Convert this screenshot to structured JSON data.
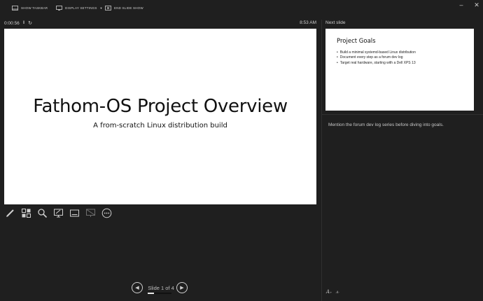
{
  "toolbar": {
    "show_taskbar": "SHOW TASKBAR",
    "display_settings": "DISPLAY SETTINGS",
    "end_slide_show": "END SLIDE SHOW"
  },
  "window": {
    "minimize": "–",
    "close": "✕"
  },
  "presenter": {
    "timer": "0:00:56",
    "clock": "8:53 AM",
    "pause_icon": "‖",
    "reset_icon": "↻"
  },
  "current_slide": {
    "title": "Fathom-OS Project Overview",
    "subtitle": "A from-scratch Linux distribution build"
  },
  "tools": [
    "pen-icon",
    "see-all-slides-icon",
    "zoom-icon",
    "pointer-screen-icon",
    "subtitles-icon",
    "black-screen-icon",
    "more-options-icon"
  ],
  "navigation": {
    "label": "Slide 1 of 4",
    "prev_icon": "◀",
    "next_icon": "▶",
    "progress": 0.25
  },
  "next_slide": {
    "label": "Next slide",
    "title": "Project Goals",
    "bullets": [
      "Build a minimal systemd-based Linux distribution",
      "Document every step as a forum dev log",
      "Target real hardware, starting with a Dell XPS 13"
    ]
  },
  "notes": {
    "text": "Mention the forum dev log series before diving into goals."
  },
  "font_controls": {
    "increase": "A",
    "decrease": "A"
  }
}
